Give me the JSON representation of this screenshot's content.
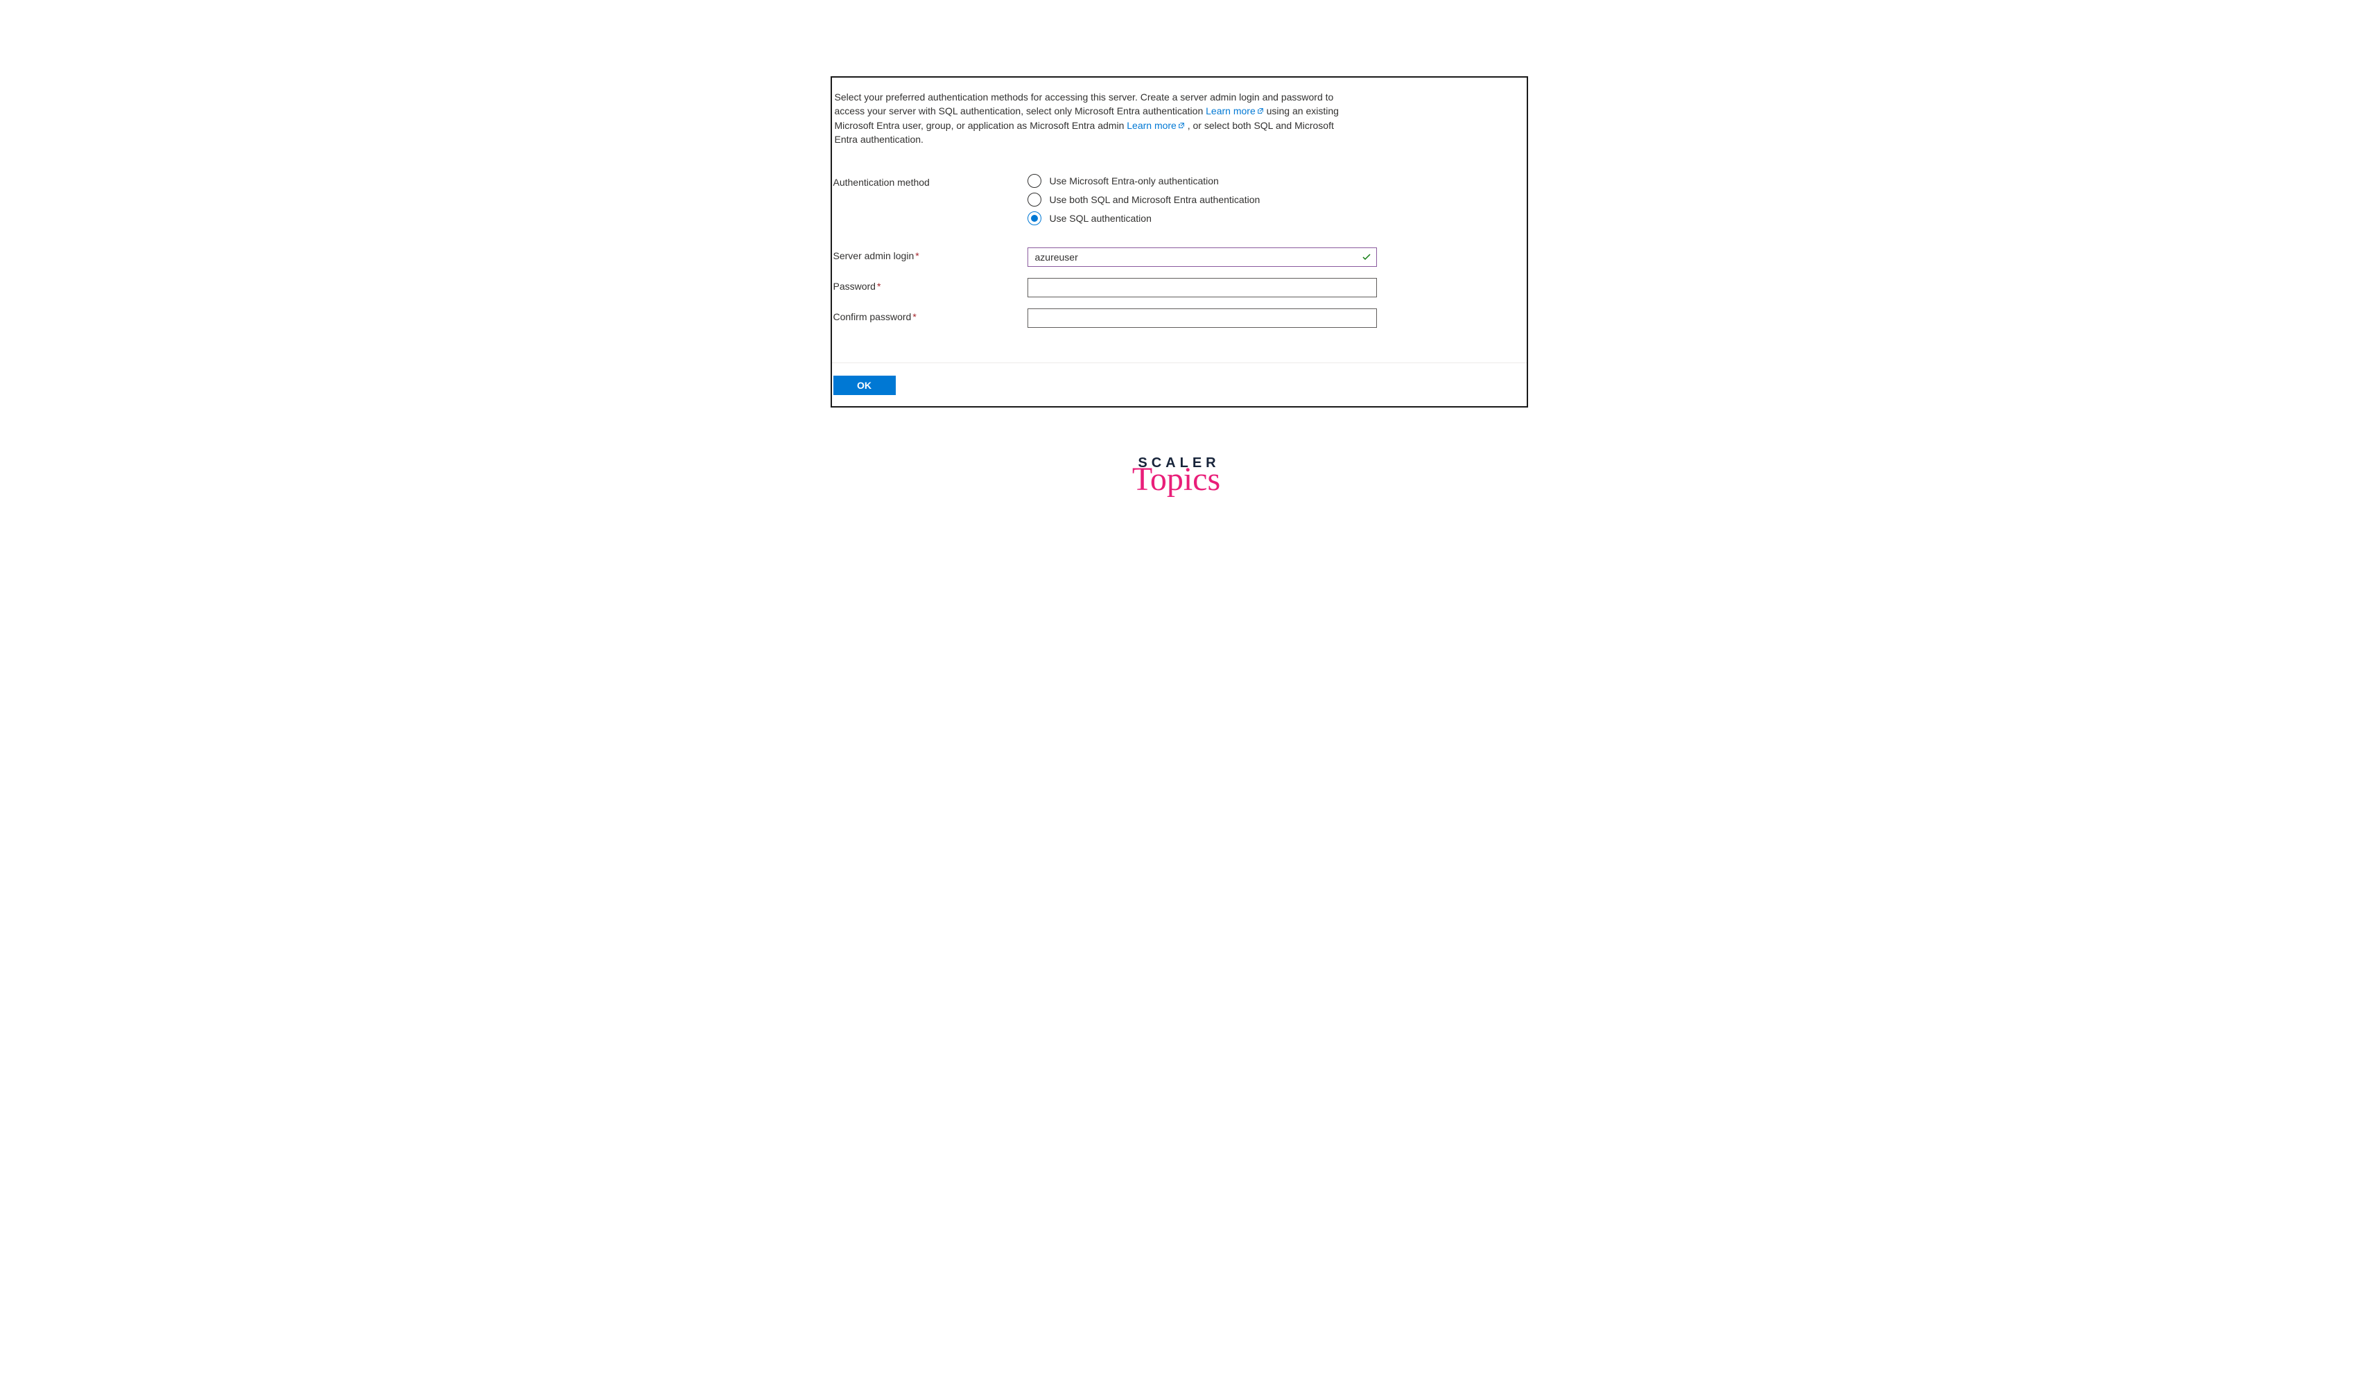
{
  "description": {
    "part1": "Select your preferred authentication methods for accessing this server. Create a server admin login and password to access your server with SQL authentication, select only Microsoft Entra authentication ",
    "learn_more_1": "Learn more",
    "part2": " using an existing Microsoft Entra user, group, or application as Microsoft Entra admin ",
    "learn_more_2": "Learn more",
    "part3": " , or select both SQL and Microsoft Entra authentication."
  },
  "labels": {
    "auth_method": "Authentication method",
    "server_admin_login": "Server admin login",
    "password": "Password",
    "confirm_password": "Confirm password"
  },
  "radio_options": {
    "entra_only": "Use Microsoft Entra-only authentication",
    "both": "Use both SQL and Microsoft Entra authentication",
    "sql": "Use SQL authentication"
  },
  "fields": {
    "server_admin_login_value": "azureuser",
    "password_value": "",
    "confirm_password_value": ""
  },
  "buttons": {
    "ok": "OK"
  },
  "logo": {
    "line1": "SCALER",
    "line2": "Topics"
  }
}
